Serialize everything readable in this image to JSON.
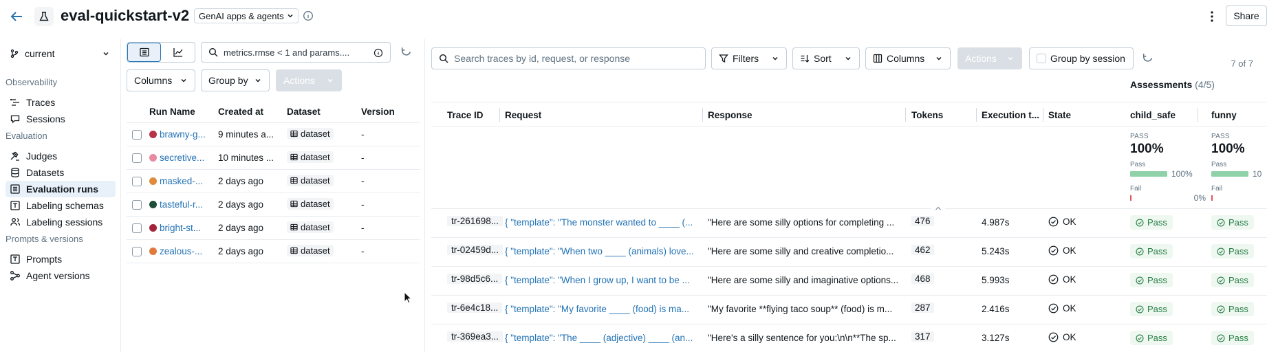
{
  "header": {
    "title": "eval-quickstart-v2",
    "type_chip": "GenAI apps & agents",
    "share_label": "Share"
  },
  "sidebar": {
    "env": "current",
    "sections": [
      {
        "label": "Observability",
        "items": [
          {
            "label": "Traces",
            "icon": "traces-icon"
          },
          {
            "label": "Sessions",
            "icon": "chat-icon"
          }
        ]
      },
      {
        "label": "Evaluation",
        "items": [
          {
            "label": "Judges",
            "icon": "gavel-icon"
          },
          {
            "label": "Datasets",
            "icon": "database-icon"
          },
          {
            "label": "Evaluation runs",
            "icon": "list-icon",
            "active": true
          },
          {
            "label": "Labeling schemas",
            "icon": "form-icon"
          },
          {
            "label": "Labeling sessions",
            "icon": "people-icon"
          }
        ]
      },
      {
        "label": "Prompts & versions",
        "items": [
          {
            "label": "Prompts",
            "icon": "prompt-icon"
          },
          {
            "label": "Agent versions",
            "icon": "versions-icon"
          }
        ]
      }
    ]
  },
  "runs_panel": {
    "search_value": "metrics.rmse < 1 and params....",
    "columns_label": "Columns",
    "group_by_label": "Group by",
    "actions_label": "Actions",
    "headers": {
      "name": "Run Name",
      "created": "Created at",
      "dataset": "Dataset",
      "version": "Version"
    },
    "rows": [
      {
        "name": "brawny-g...",
        "color": "#b8334a",
        "created": "9 minutes a...",
        "dataset": "dataset",
        "version": "-"
      },
      {
        "name": "secretive...",
        "color": "#e88aa0",
        "created": "10 minutes ...",
        "dataset": "dataset",
        "version": "-"
      },
      {
        "name": "masked-...",
        "color": "#e08a3c",
        "created": "2 days ago",
        "dataset": "dataset",
        "version": "-"
      },
      {
        "name": "tasteful-r...",
        "color": "#1f4d3a",
        "created": "2 days ago",
        "dataset": "dataset",
        "version": "-"
      },
      {
        "name": "bright-st...",
        "color": "#a3243b",
        "created": "2 days ago",
        "dataset": "dataset",
        "version": "-"
      },
      {
        "name": "zealous-...",
        "color": "#e07a3c",
        "created": "2 days ago",
        "dataset": "dataset",
        "version": "-"
      }
    ]
  },
  "traces_panel": {
    "search_placeholder": "Search traces by id, request, or response",
    "filters_label": "Filters",
    "sort_label": "Sort",
    "columns_label": "Columns",
    "actions_label": "Actions",
    "group_session_label": "Group by session",
    "count": "7 of 7",
    "assessments_label": "Assessments",
    "assessments_count": "(4/5)",
    "headers": {
      "trace_id": "Trace ID",
      "request": "Request",
      "response": "Response",
      "tokens": "Tokens",
      "exec": "Execution t...",
      "state": "State",
      "a1": "child_safe",
      "a2": "funny"
    },
    "summary": [
      {
        "label": "PASS",
        "pct": "100%",
        "pass_label": "Pass",
        "pass_pct": "100%",
        "pass_fraction": 1.0,
        "fail_label": "Fail",
        "fail_pct": "0%"
      },
      {
        "label": "PASS",
        "pct": "100%",
        "pass_label": "Pass",
        "pass_pct": "10",
        "pass_fraction": 1.0,
        "fail_label": "Fail",
        "fail_pct": ""
      }
    ],
    "rows": [
      {
        "id": "tr-261698...",
        "request": "{ \"template\": \"The monster wanted to ____ (...",
        "response": "\"Here are some silly options for completing ...",
        "tokens": "476",
        "exec": "4.987s",
        "state": "OK",
        "a1": "Pass",
        "a2": "Pass"
      },
      {
        "id": "tr-02459d...",
        "request": "{ \"template\": \"When two ____ (animals) love...",
        "response": "\"Here are some silly and creative completio...",
        "tokens": "462",
        "exec": "5.243s",
        "state": "OK",
        "a1": "Pass",
        "a2": "Pass"
      },
      {
        "id": "tr-98d5c6...",
        "request": "{ \"template\": \"When I grow up, I want to be ...",
        "response": "\"Here are some silly and imaginative options...",
        "tokens": "468",
        "exec": "5.993s",
        "state": "OK",
        "a1": "Pass",
        "a2": "Pass"
      },
      {
        "id": "tr-6e4c18...",
        "request": "{ \"template\": \"My favorite ____ (food) is ma...",
        "response": "\"My favorite **flying taco soup** (food) is m...",
        "tokens": "287",
        "exec": "2.416s",
        "state": "OK",
        "a1": "Pass",
        "a2": "Pass"
      },
      {
        "id": "tr-369ea3...",
        "request": "{ \"template\": \"The ____ (adjective) ____ (an...",
        "response": "\"Here's a silly sentence for you:\\n\\n**The sp...",
        "tokens": "317",
        "exec": "3.127s",
        "state": "OK",
        "a1": "Pass",
        "a2": "Pass"
      }
    ]
  },
  "colors": {
    "accent": "#2272b4",
    "pass_bg": "#eef8f1",
    "pass_fg": "#277c43",
    "bar_pass": "#8fd1a8",
    "bar_fail": "#e0555b"
  }
}
